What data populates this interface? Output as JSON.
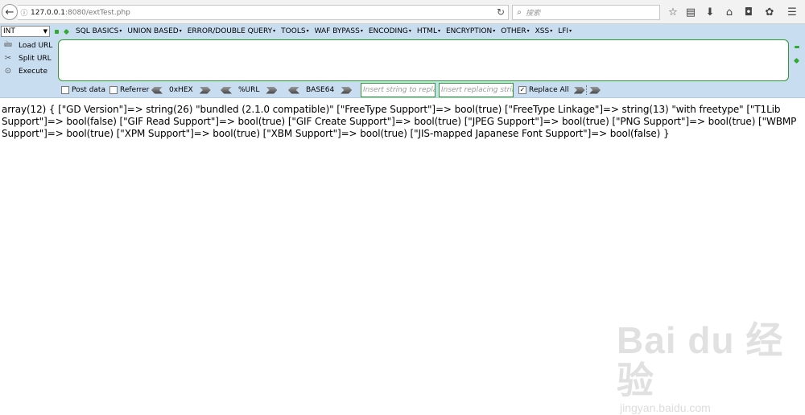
{
  "browser": {
    "url_host": "127.0.0.1",
    "url_rest": ":8080/extTest.php",
    "search_placeholder": "搜索"
  },
  "hackbar": {
    "select_value": "INT",
    "menu": [
      "SQL BASICS",
      "UNION BASED",
      "ERROR/DOUBLE QUERY",
      "TOOLS",
      "WAF BYPASS",
      "ENCODING",
      "HTML",
      "ENCRYPTION",
      "OTHER",
      "XSS",
      "LFI"
    ],
    "load_url": "Load URL",
    "split_url": "Split URL",
    "execute": "Execute",
    "post_data": "Post data",
    "referrer": "Referrer",
    "hex": "0xHEX",
    "urlenc": "%URL",
    "base64": "BASE64",
    "replace_placeholder": "Insert string to replace",
    "replacing_placeholder": "Insert replacing string",
    "replace_all": "Replace All",
    "replace_all_checked": true
  },
  "output": {
    "text": "array(12) { [\"GD Version\"]=> string(26) \"bundled (2.1.0 compatible)\" [\"FreeType Support\"]=> bool(true) [\"FreeType Linkage\"]=> string(13) \"with freetype\" [\"T1Lib Support\"]=> bool(false) [\"GIF Read Support\"]=> bool(true) [\"GIF Create Support\"]=> bool(true) [\"JPEG Support\"]=> bool(true) [\"PNG Support\"]=> bool(true) [\"WBMP Support\"]=> bool(true) [\"XPM Support\"]=> bool(true) [\"XBM Support\"]=> bool(true) [\"JIS-mapped Japanese Font Support\"]=> bool(false) }"
  },
  "watermark": {
    "brand": "Bai du 经验",
    "domain": "jingyan.baidu.com"
  }
}
